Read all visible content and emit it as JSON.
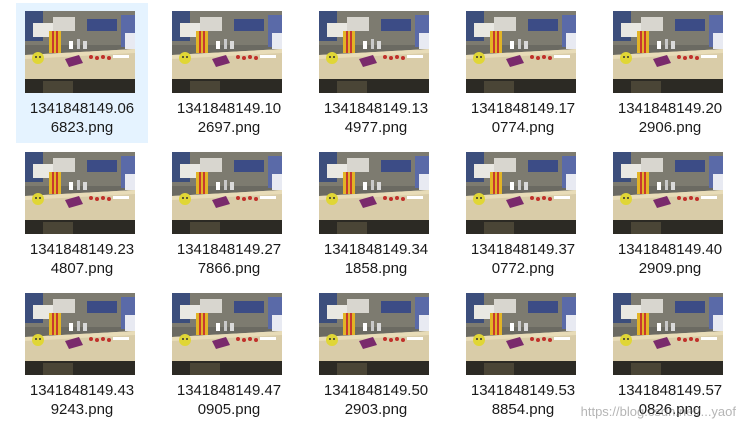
{
  "files": [
    {
      "line1": "1341848149.06",
      "line2": "6823.png",
      "selected": true
    },
    {
      "line1": "1341848149.10",
      "line2": "2697.png"
    },
    {
      "line1": "1341848149.13",
      "line2": "4977.png"
    },
    {
      "line1": "1341848149.17",
      "line2": "0774.png"
    },
    {
      "line1": "1341848149.20",
      "line2": "2906.png"
    },
    {
      "line1": "1341848149.23",
      "line2": "4807.png"
    },
    {
      "line1": "1341848149.27",
      "line2": "7866.png"
    },
    {
      "line1": "1341848149.34",
      "line2": "1858.png"
    },
    {
      "line1": "1341848149.37",
      "line2": "0772.png"
    },
    {
      "line1": "1341848149.40",
      "line2": "2909.png"
    },
    {
      "line1": "1341848149.43",
      "line2": "9243.png"
    },
    {
      "line1": "1341848149.47",
      "line2": "0905.png"
    },
    {
      "line1": "1341848149.50",
      "line2": "2903.png"
    },
    {
      "line1": "1341848149.53",
      "line2": "8854.png"
    },
    {
      "line1": "1341848149.57",
      "line2": "0826.png"
    }
  ],
  "watermark": "https://blog.csdn.net/...yaof",
  "colors": {
    "selection_background": "#e5f3ff",
    "label_text": "#1a1a1a"
  }
}
